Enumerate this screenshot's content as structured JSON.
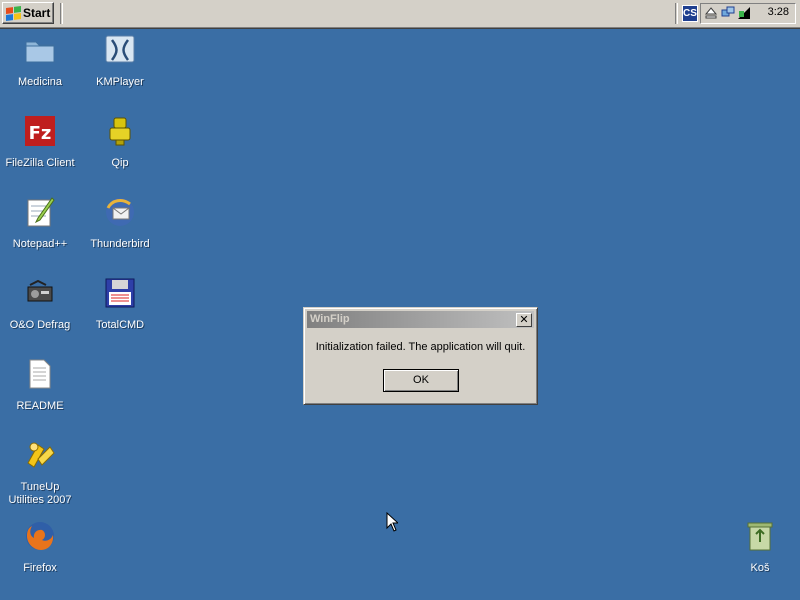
{
  "taskbar": {
    "start_label": "Start",
    "lang_indicator": "CS",
    "clock": "3:28",
    "tray_icons": [
      "eject-icon",
      "network-icon",
      "volume-icon"
    ]
  },
  "desktop": {
    "background": "#3a6ea5",
    "icons": [
      {
        "name": "folder-icon",
        "label": "Medicina"
      },
      {
        "name": "kmplayer-icon",
        "label": "KMPlayer"
      },
      {
        "name": "filezilla-icon",
        "label": "FileZilla Client"
      },
      {
        "name": "qip-icon",
        "label": "Qip"
      },
      {
        "name": "notepad-icon",
        "label": "Notepad++"
      },
      {
        "name": "thunderbird-icon",
        "label": "Thunderbird"
      },
      {
        "name": "defrag-icon",
        "label": "O&O Defrag"
      },
      {
        "name": "totalcmd-icon",
        "label": "TotalCMD"
      },
      {
        "name": "document-icon",
        "label": "README"
      },
      {
        "name": "tuneup-icon",
        "label": "TuneUp Utilities 2007"
      },
      {
        "name": "firefox-icon",
        "label": "Firefox"
      },
      {
        "name": "recycle-bin-icon",
        "label": "Koš"
      }
    ]
  },
  "dialog": {
    "title": "WinFlip",
    "close_glyph": "✕",
    "message": "Initialization failed. The application will quit.",
    "ok_label": "OK"
  }
}
